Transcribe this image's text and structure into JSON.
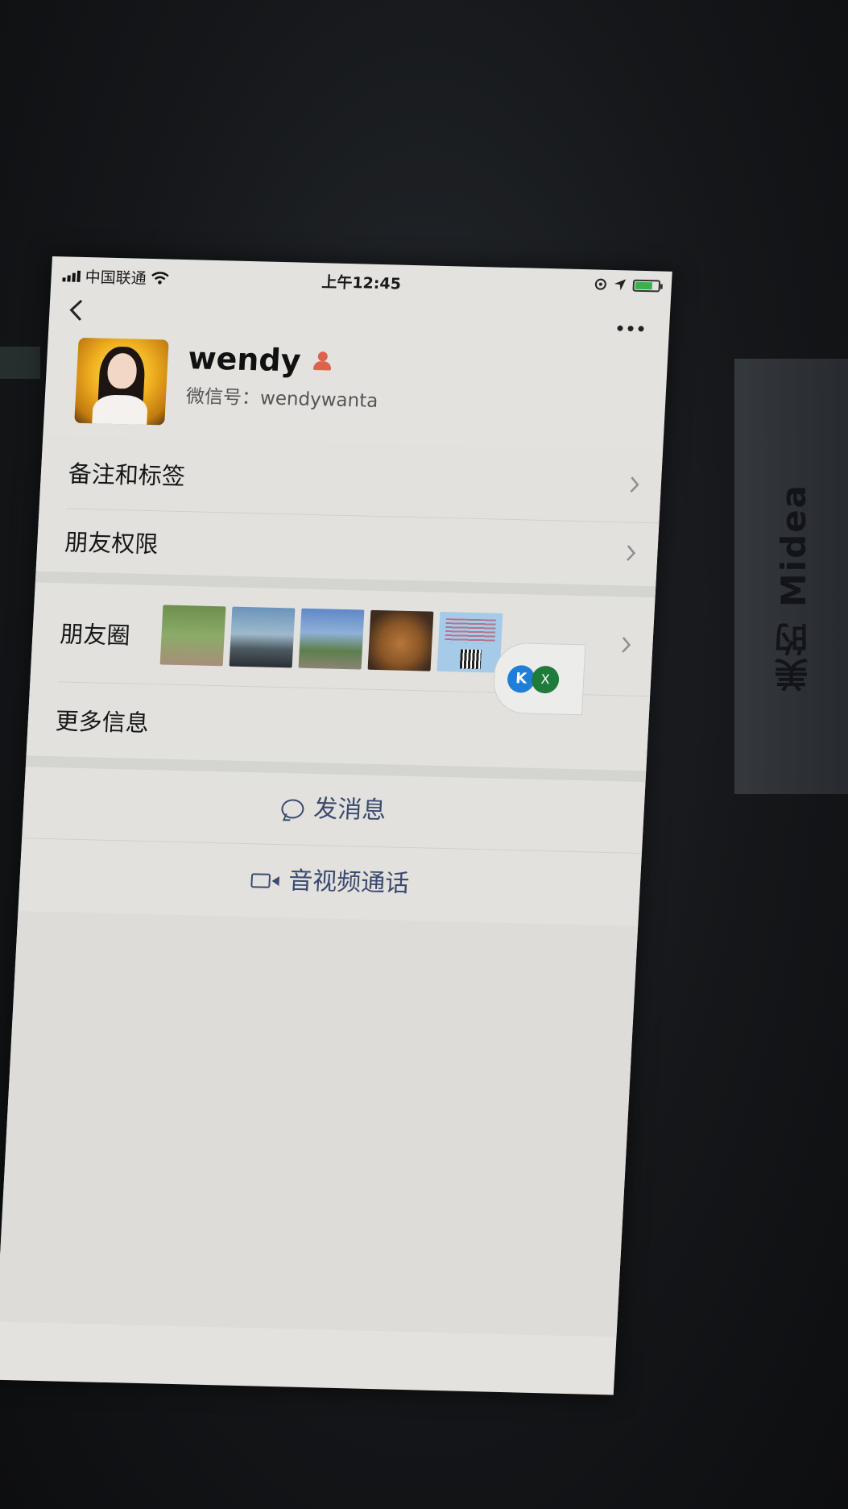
{
  "status_bar": {
    "carrier": "中国联通",
    "time": "上午12:45"
  },
  "nav": {
    "back_icon": "chevron-left-icon",
    "more_icon": "more-icon"
  },
  "profile": {
    "name": "wendy",
    "wechat_id": "微信号：wendywanta",
    "gender_icon": "female-person-icon",
    "gender_color": "#e0614c"
  },
  "menu": {
    "remarks_label": "备注和标签",
    "permissions_label": "朋友权限",
    "moments_label": "朋友圈",
    "more_info_label": "更多信息"
  },
  "actions": {
    "message_label": "发消息",
    "call_label": "音视频通话",
    "accent_color": "#3b4a6e"
  },
  "floating": {
    "badge2_text": "X"
  },
  "background": {
    "side_text": "美的 Midea"
  }
}
